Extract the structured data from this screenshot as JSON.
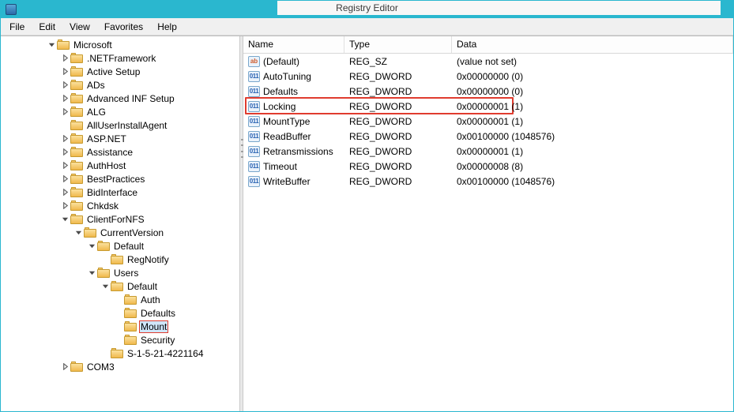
{
  "window": {
    "title": "Registry Editor"
  },
  "menubar": {
    "file": "File",
    "edit": "Edit",
    "view": "View",
    "favorites": "Favorites",
    "help": "Help"
  },
  "columns": {
    "name": "Name",
    "type": "Type",
    "data": "Data"
  },
  "tree": {
    "root": "Microsoft",
    "n_netframework": ".NETFramework",
    "n_activesetup": "Active Setup",
    "n_ads": "ADs",
    "n_advinf": "Advanced INF Setup",
    "n_alg": "ALG",
    "n_alluser": "AllUserInstallAgent",
    "n_aspnet": "ASP.NET",
    "n_assist": "Assistance",
    "n_authhost": "AuthHost",
    "n_best": "BestPractices",
    "n_bidi": "BidInterface",
    "n_chkdsk": "Chkdsk",
    "n_clientnfs": "ClientForNFS",
    "n_curver": "CurrentVersion",
    "n_default1": "Default",
    "n_regnotify": "RegNotify",
    "n_users": "Users",
    "n_default2": "Default",
    "n_auth": "Auth",
    "n_defaults": "Defaults",
    "n_mount": "Mount",
    "n_security": "Security",
    "n_sid": "S-1-5-21-4221164",
    "n_com3": "COM3"
  },
  "values": [
    {
      "icon": "str",
      "name": "(Default)",
      "type": "REG_SZ",
      "data": "(value not set)"
    },
    {
      "icon": "num",
      "name": "AutoTuning",
      "type": "REG_DWORD",
      "data": "0x00000000 (0)"
    },
    {
      "icon": "num",
      "name": "Defaults",
      "type": "REG_DWORD",
      "data": "0x00000000 (0)"
    },
    {
      "icon": "num",
      "name": "Locking",
      "type": "REG_DWORD",
      "data": "0x00000001 (1)"
    },
    {
      "icon": "num",
      "name": "MountType",
      "type": "REG_DWORD",
      "data": "0x00000001 (1)"
    },
    {
      "icon": "num",
      "name": "ReadBuffer",
      "type": "REG_DWORD",
      "data": "0x00100000 (1048576)"
    },
    {
      "icon": "num",
      "name": "Retransmissions",
      "type": "REG_DWORD",
      "data": "0x00000001 (1)"
    },
    {
      "icon": "num",
      "name": "Timeout",
      "type": "REG_DWORD",
      "data": "0x00000008 (8)"
    },
    {
      "icon": "num",
      "name": "WriteBuffer",
      "type": "REG_DWORD",
      "data": "0x00100000 (1048576)"
    }
  ],
  "icon_glyphs": {
    "str": "ab",
    "num": "011"
  }
}
